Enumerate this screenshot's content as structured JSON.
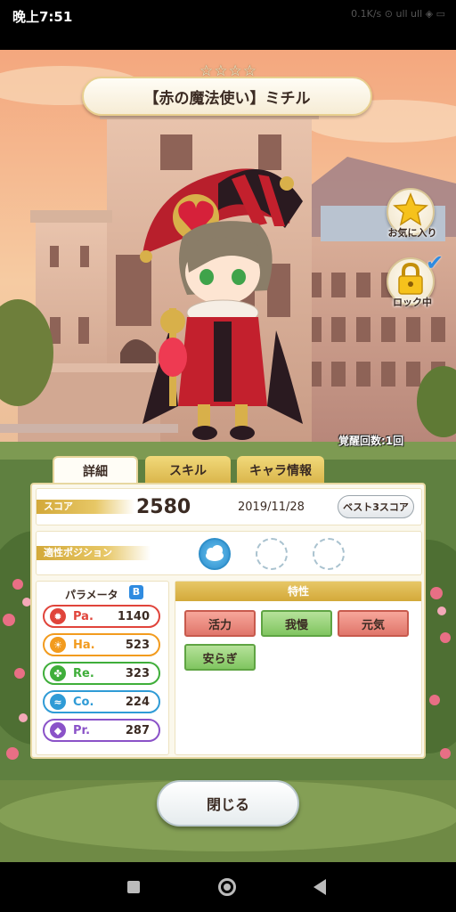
{
  "status_bar": {
    "time": "晚上7:51",
    "right_text": "0.1K/s ⊙ ull ull ◈ ▭"
  },
  "card": {
    "title": "【赤の魔法使い】ミチル",
    "stars": [
      "☆",
      "☆",
      "☆",
      "☆"
    ],
    "awaken_label": "覚醒回数:1回"
  },
  "side_buttons": {
    "favorite_label": "お気に入り",
    "lock_label": "ロック中"
  },
  "tabs": [
    {
      "label": "詳細",
      "active": true
    },
    {
      "label": "スキル",
      "active": false
    },
    {
      "label": "キャラ情報",
      "active": false
    }
  ],
  "score": {
    "label": "スコア",
    "value": "2580",
    "date": "2019/11/28",
    "best_button": "ベスト3スコア"
  },
  "position": {
    "label": "適性ポジション"
  },
  "params": {
    "title": "パラメータ",
    "rank": "B",
    "items": [
      {
        "name": "Pa.",
        "value": "1140",
        "color": "#e0443b",
        "icon": "flame-icon",
        "glyph": "✹"
      },
      {
        "name": "Ha.",
        "value": "523",
        "color": "#f29b1e",
        "icon": "sun-icon",
        "glyph": "☀"
      },
      {
        "name": "Re.",
        "value": "323",
        "color": "#3fae3a",
        "icon": "clover-icon",
        "glyph": "✤"
      },
      {
        "name": "Co.",
        "value": "224",
        "color": "#2f9bd6",
        "icon": "wave-icon",
        "glyph": "≈"
      },
      {
        "name": "Pr.",
        "value": "287",
        "color": "#8a52c8",
        "icon": "diamond-icon",
        "glyph": "◆"
      }
    ]
  },
  "traits": {
    "title": "特性",
    "items": [
      {
        "label": "活力",
        "style": "red"
      },
      {
        "label": "我慢",
        "style": "green"
      },
      {
        "label": "元気",
        "style": "red"
      },
      {
        "label": "安らぎ",
        "style": "green"
      }
    ]
  },
  "close_button": "閉じる"
}
